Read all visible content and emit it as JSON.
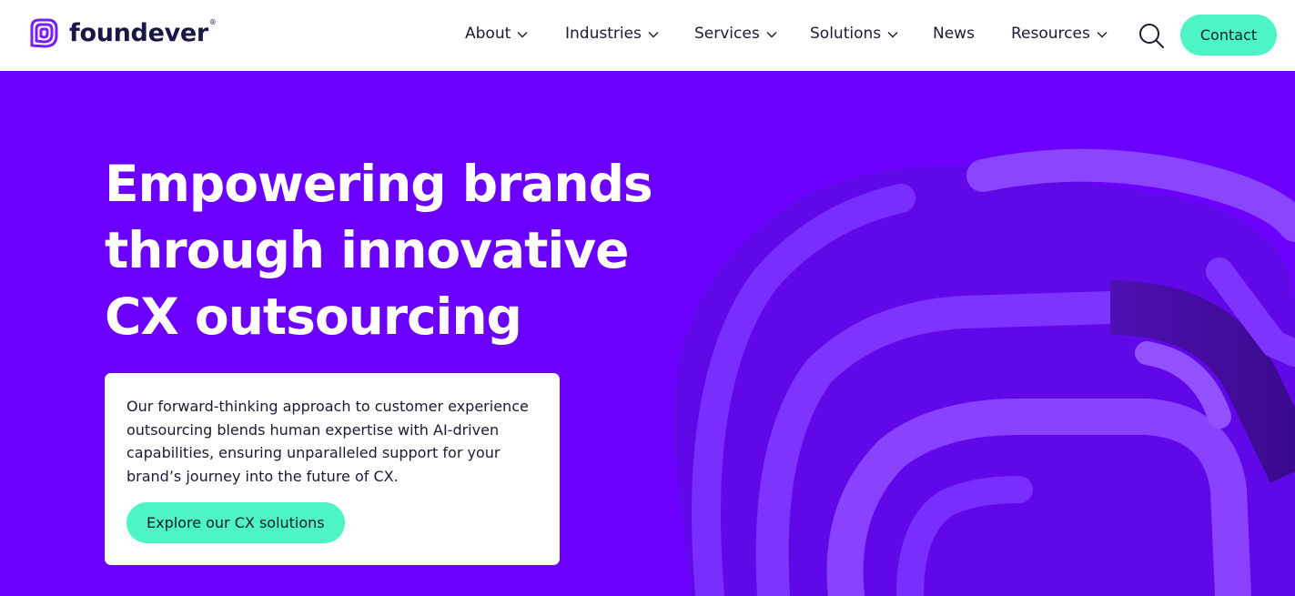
{
  "brand": {
    "name": "foundever",
    "registered_mark": "®",
    "logo_icon": "foundever-logo-icon"
  },
  "nav": {
    "items": [
      {
        "label": "About",
        "dropdown": true
      },
      {
        "label": "Industries",
        "dropdown": true
      },
      {
        "label": "Services",
        "dropdown": true
      },
      {
        "label": "Solutions",
        "dropdown": true
      },
      {
        "label": "News",
        "dropdown": false
      },
      {
        "label": "Resources",
        "dropdown": true
      }
    ],
    "search_icon": "search-icon",
    "contact_label": "Contact"
  },
  "hero": {
    "title_lines": [
      "Empowering brands",
      "through innovative",
      "CX outsourcing"
    ],
    "description": "Our forward-thinking approach to customer experience outsourcing blends human expertise with AI-driven capabilities, ensuring unparalleled support for your brand’s journey into the future of CX.",
    "cta_label": "Explore our CX solutions"
  },
  "colors": {
    "hero_background": "#6b00ff",
    "accent": "#4cf5c3",
    "text_dark": "#1b1b2f",
    "logo_purple": "#7a1cff"
  }
}
